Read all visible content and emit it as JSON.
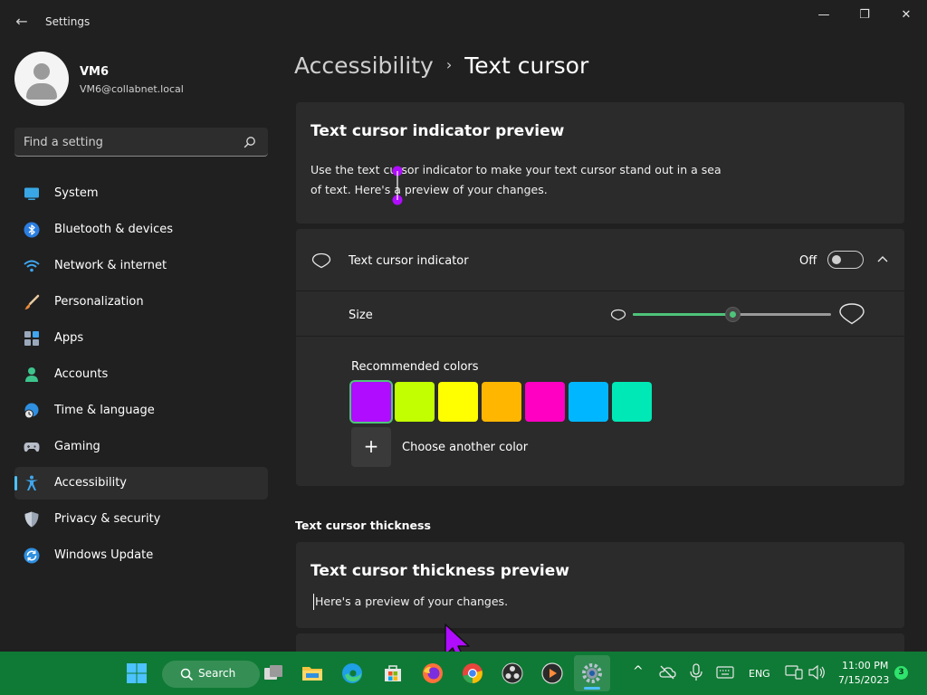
{
  "window": {
    "title": "Settings",
    "back_glyph": "←",
    "minimize_glyph": "—",
    "maximize_glyph": "❐",
    "close_glyph": "✕"
  },
  "user": {
    "name": "VM6",
    "email": "VM6@collabnet.local"
  },
  "search": {
    "placeholder": "Find a setting"
  },
  "sidebar": {
    "items": [
      {
        "label": "System",
        "icon": "monitor-icon"
      },
      {
        "label": "Bluetooth & devices",
        "icon": "bluetooth-icon"
      },
      {
        "label": "Network & internet",
        "icon": "wifi-icon"
      },
      {
        "label": "Personalization",
        "icon": "brush-icon"
      },
      {
        "label": "Apps",
        "icon": "apps-icon"
      },
      {
        "label": "Accounts",
        "icon": "person-icon"
      },
      {
        "label": "Time & language",
        "icon": "globe-clock-icon"
      },
      {
        "label": "Gaming",
        "icon": "gamepad-icon"
      },
      {
        "label": "Accessibility",
        "icon": "accessibility-icon",
        "active": true
      },
      {
        "label": "Privacy & security",
        "icon": "shield-icon"
      },
      {
        "label": "Windows Update",
        "icon": "update-icon"
      }
    ]
  },
  "breadcrumb": {
    "parent": "Accessibility",
    "separator": "›",
    "current": "Text cursor"
  },
  "preview": {
    "title": "Text cursor indicator preview",
    "line1": "Use the text cursor indicator to make your text cursor stand out in a sea",
    "line2": "of text. Here's a preview of your changes."
  },
  "indicator": {
    "label": "Text cursor indicator",
    "state_label": "Off",
    "enabled": false
  },
  "size": {
    "label": "Size",
    "level": 0.5
  },
  "colors": {
    "label": "Recommended colors",
    "swatches": [
      "#b00cff",
      "#c2ff00",
      "#ffff00",
      "#ffb600",
      "#ff00c3",
      "#00b7ff",
      "#00e8b6"
    ],
    "selected_index": 0,
    "add_label": "Choose another color",
    "add_glyph": "+"
  },
  "thickness": {
    "section_title": "Text cursor thickness",
    "preview_title": "Text cursor thickness preview",
    "preview_text": "Here's a preview of your changes."
  },
  "taskbar": {
    "search_label": "Search",
    "language": "ENG",
    "time": "11:00 PM",
    "date": "7/15/2023",
    "notification_count": "3",
    "chevron_glyph": "^"
  },
  "colors_theme": {
    "accent": "#4cc2ff",
    "slider_green": "#4ec47a",
    "taskbar": "#0f7a35",
    "cursor_indicator": "#b00cff"
  }
}
